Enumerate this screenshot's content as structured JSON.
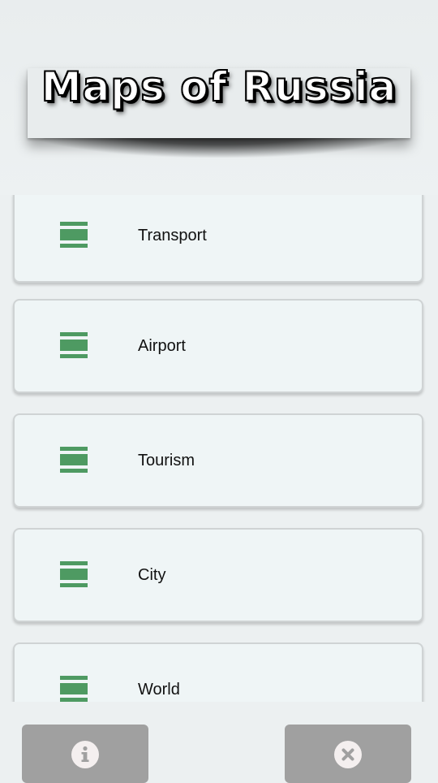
{
  "header": {
    "title": "Maps of Russia"
  },
  "menu": {
    "items": [
      {
        "label": "Transport",
        "icon": "menu-bars-icon"
      },
      {
        "label": "Airport",
        "icon": "menu-bars-icon"
      },
      {
        "label": "Tourism",
        "icon": "menu-bars-icon"
      },
      {
        "label": "City",
        "icon": "menu-bars-icon"
      },
      {
        "label": "World",
        "icon": "menu-bars-icon"
      }
    ]
  },
  "footer": {
    "info_icon": "info-icon",
    "close_icon": "close-icon"
  },
  "colors": {
    "background": "#ecf0f1",
    "card": "#eff5f6",
    "icon_green": "#4e9a62",
    "footer_button": "#a0a0a0"
  }
}
